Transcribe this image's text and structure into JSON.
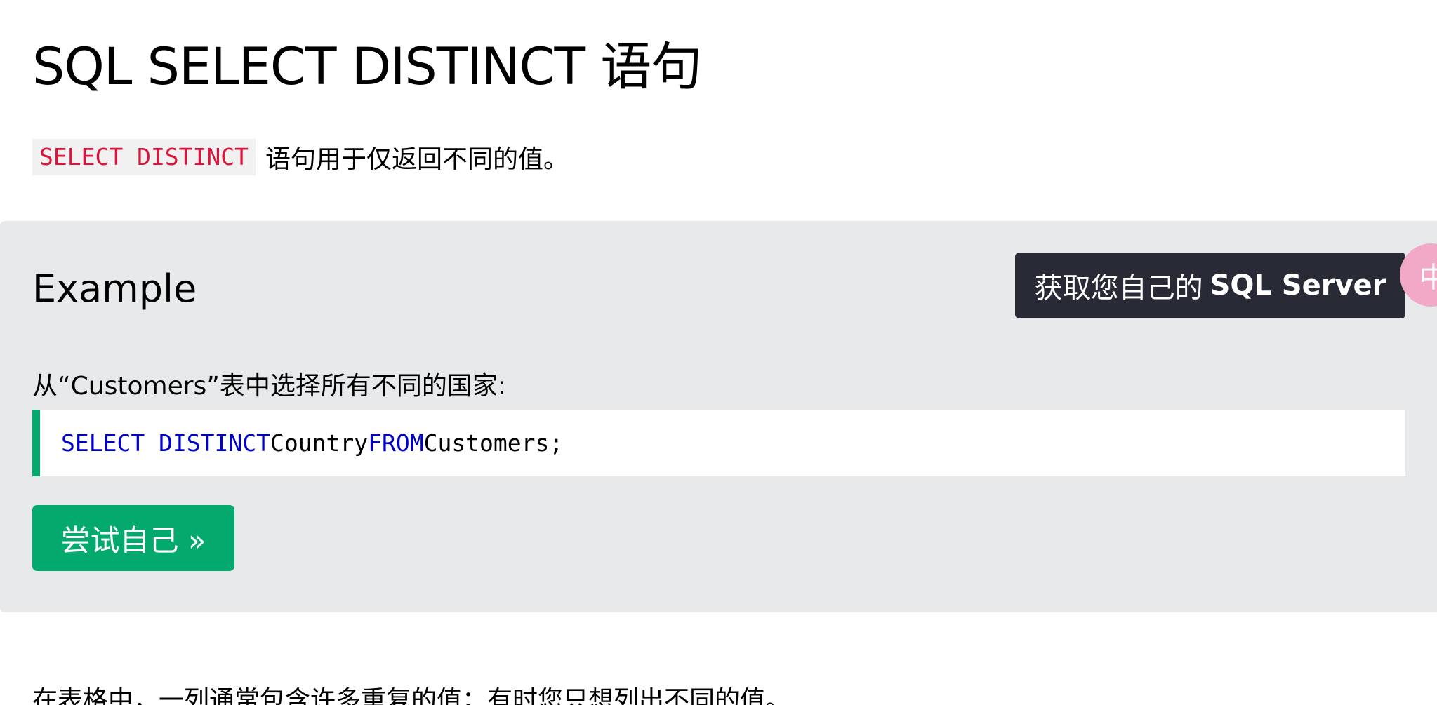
{
  "page": {
    "title": "SQL SELECT DISTINCT 语句"
  },
  "intro": {
    "code": "SELECT DISTINCT",
    "text": "语句用于仅返回不同的值。"
  },
  "example": {
    "heading": "Example",
    "description": "从“Customers”表中选择所有不同的国家:",
    "code": {
      "kw1": "SELECT DISTINCT",
      "ident1": "Country",
      "kw2": "FROM",
      "ident2": "Customers;"
    },
    "try_button_label": "尝试自己 »",
    "server_button": {
      "label_cn": "获取您自己的",
      "label_bold": "SQL Server"
    },
    "float_circle_char": "中"
  },
  "bottom": {
    "text": "在表格中，一列通常包含许多重复的值；有时您只想列出不同的值。"
  },
  "colors": {
    "accent_green": "#04aa6d",
    "inline_code_red": "#dc143c",
    "keyword_blue": "#0000cd",
    "example_bg": "#e7e9eb",
    "dark_button": "#282a35",
    "pink_circle": "#f2a9c8"
  }
}
